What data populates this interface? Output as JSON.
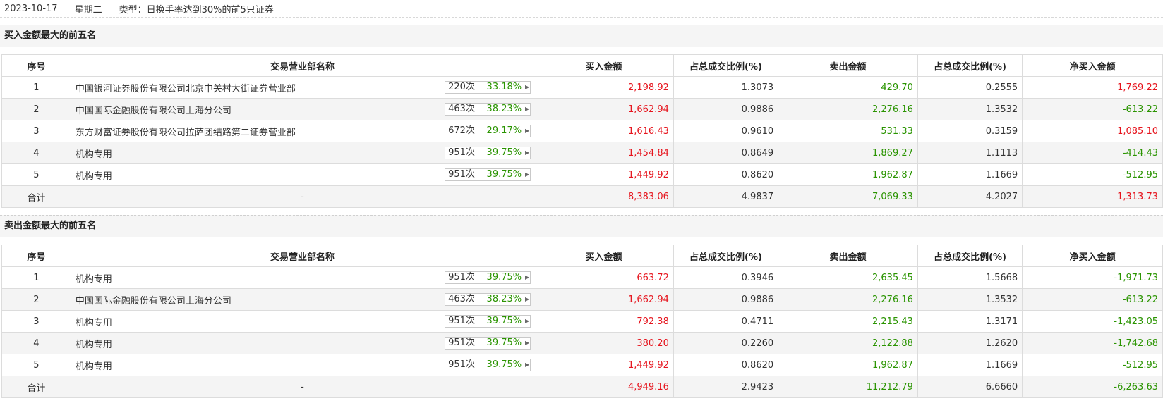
{
  "header": {
    "date": "2023-10-17",
    "weekday": "星期二",
    "type": "类型：日换手率达到30%的前5只证券"
  },
  "columns": [
    "序号",
    "交易营业部名称",
    "买入金额",
    "占总成交比例(%)",
    "卖出金额",
    "占总成交比例(%)",
    "净买入金额"
  ],
  "colors": {
    "red": "#e6141d",
    "green": "#2a9400"
  },
  "buy": {
    "title": "买入金额最大的前五名",
    "rows": [
      {
        "no": "1",
        "name": "中国银河证券股份有限公司北京中关村大街证券营业部",
        "times": "220次",
        "pct": "33.18%",
        "buy": "2,198.92",
        "buyr": "1.3073",
        "sell": "429.70",
        "sellr": "0.2555",
        "net": "1,769.22",
        "net_dir": "red"
      },
      {
        "no": "2",
        "name": "中国国际金融股份有限公司上海分公司",
        "times": "463次",
        "pct": "38.23%",
        "buy": "1,662.94",
        "buyr": "0.9886",
        "sell": "2,276.16",
        "sellr": "1.3532",
        "net": "-613.22",
        "net_dir": "green"
      },
      {
        "no": "3",
        "name": "东方财富证券股份有限公司拉萨团结路第二证券营业部",
        "times": "672次",
        "pct": "29.17%",
        "buy": "1,616.43",
        "buyr": "0.9610",
        "sell": "531.33",
        "sellr": "0.3159",
        "net": "1,085.10",
        "net_dir": "red"
      },
      {
        "no": "4",
        "name": "机构专用",
        "times": "951次",
        "pct": "39.75%",
        "buy": "1,454.84",
        "buyr": "0.8649",
        "sell": "1,869.27",
        "sellr": "1.1113",
        "net": "-414.43",
        "net_dir": "green"
      },
      {
        "no": "5",
        "name": "机构专用",
        "times": "951次",
        "pct": "39.75%",
        "buy": "1,449.92",
        "buyr": "0.8620",
        "sell": "1,962.87",
        "sellr": "1.1669",
        "net": "-512.95",
        "net_dir": "green"
      }
    ],
    "total": {
      "label": "合计",
      "name": "-",
      "buy": "8,383.06",
      "buyr": "4.9837",
      "sell": "7,069.33",
      "sellr": "4.2027",
      "net": "1,313.73",
      "net_dir": "red"
    }
  },
  "sell": {
    "title": "卖出金额最大的前五名",
    "rows": [
      {
        "no": "1",
        "name": "机构专用",
        "times": "951次",
        "pct": "39.75%",
        "buy": "663.72",
        "buyr": "0.3946",
        "sell": "2,635.45",
        "sellr": "1.5668",
        "net": "-1,971.73",
        "net_dir": "green"
      },
      {
        "no": "2",
        "name": "中国国际金融股份有限公司上海分公司",
        "times": "463次",
        "pct": "38.23%",
        "buy": "1,662.94",
        "buyr": "0.9886",
        "sell": "2,276.16",
        "sellr": "1.3532",
        "net": "-613.22",
        "net_dir": "green"
      },
      {
        "no": "3",
        "name": "机构专用",
        "times": "951次",
        "pct": "39.75%",
        "buy": "792.38",
        "buyr": "0.4711",
        "sell": "2,215.43",
        "sellr": "1.3171",
        "net": "-1,423.05",
        "net_dir": "green"
      },
      {
        "no": "4",
        "name": "机构专用",
        "times": "951次",
        "pct": "39.75%",
        "buy": "380.20",
        "buyr": "0.2260",
        "sell": "2,122.88",
        "sellr": "1.2620",
        "net": "-1,742.68",
        "net_dir": "green"
      },
      {
        "no": "5",
        "name": "机构专用",
        "times": "951次",
        "pct": "39.75%",
        "buy": "1,449.92",
        "buyr": "0.8620",
        "sell": "1,962.87",
        "sellr": "1.1669",
        "net": "-512.95",
        "net_dir": "green"
      }
    ],
    "total": {
      "label": "合计",
      "name": "-",
      "buy": "4,949.16",
      "buyr": "2.9423",
      "sell": "11,212.79",
      "sellr": "6.6660",
      "net": "-6,263.63",
      "net_dir": "green"
    }
  }
}
